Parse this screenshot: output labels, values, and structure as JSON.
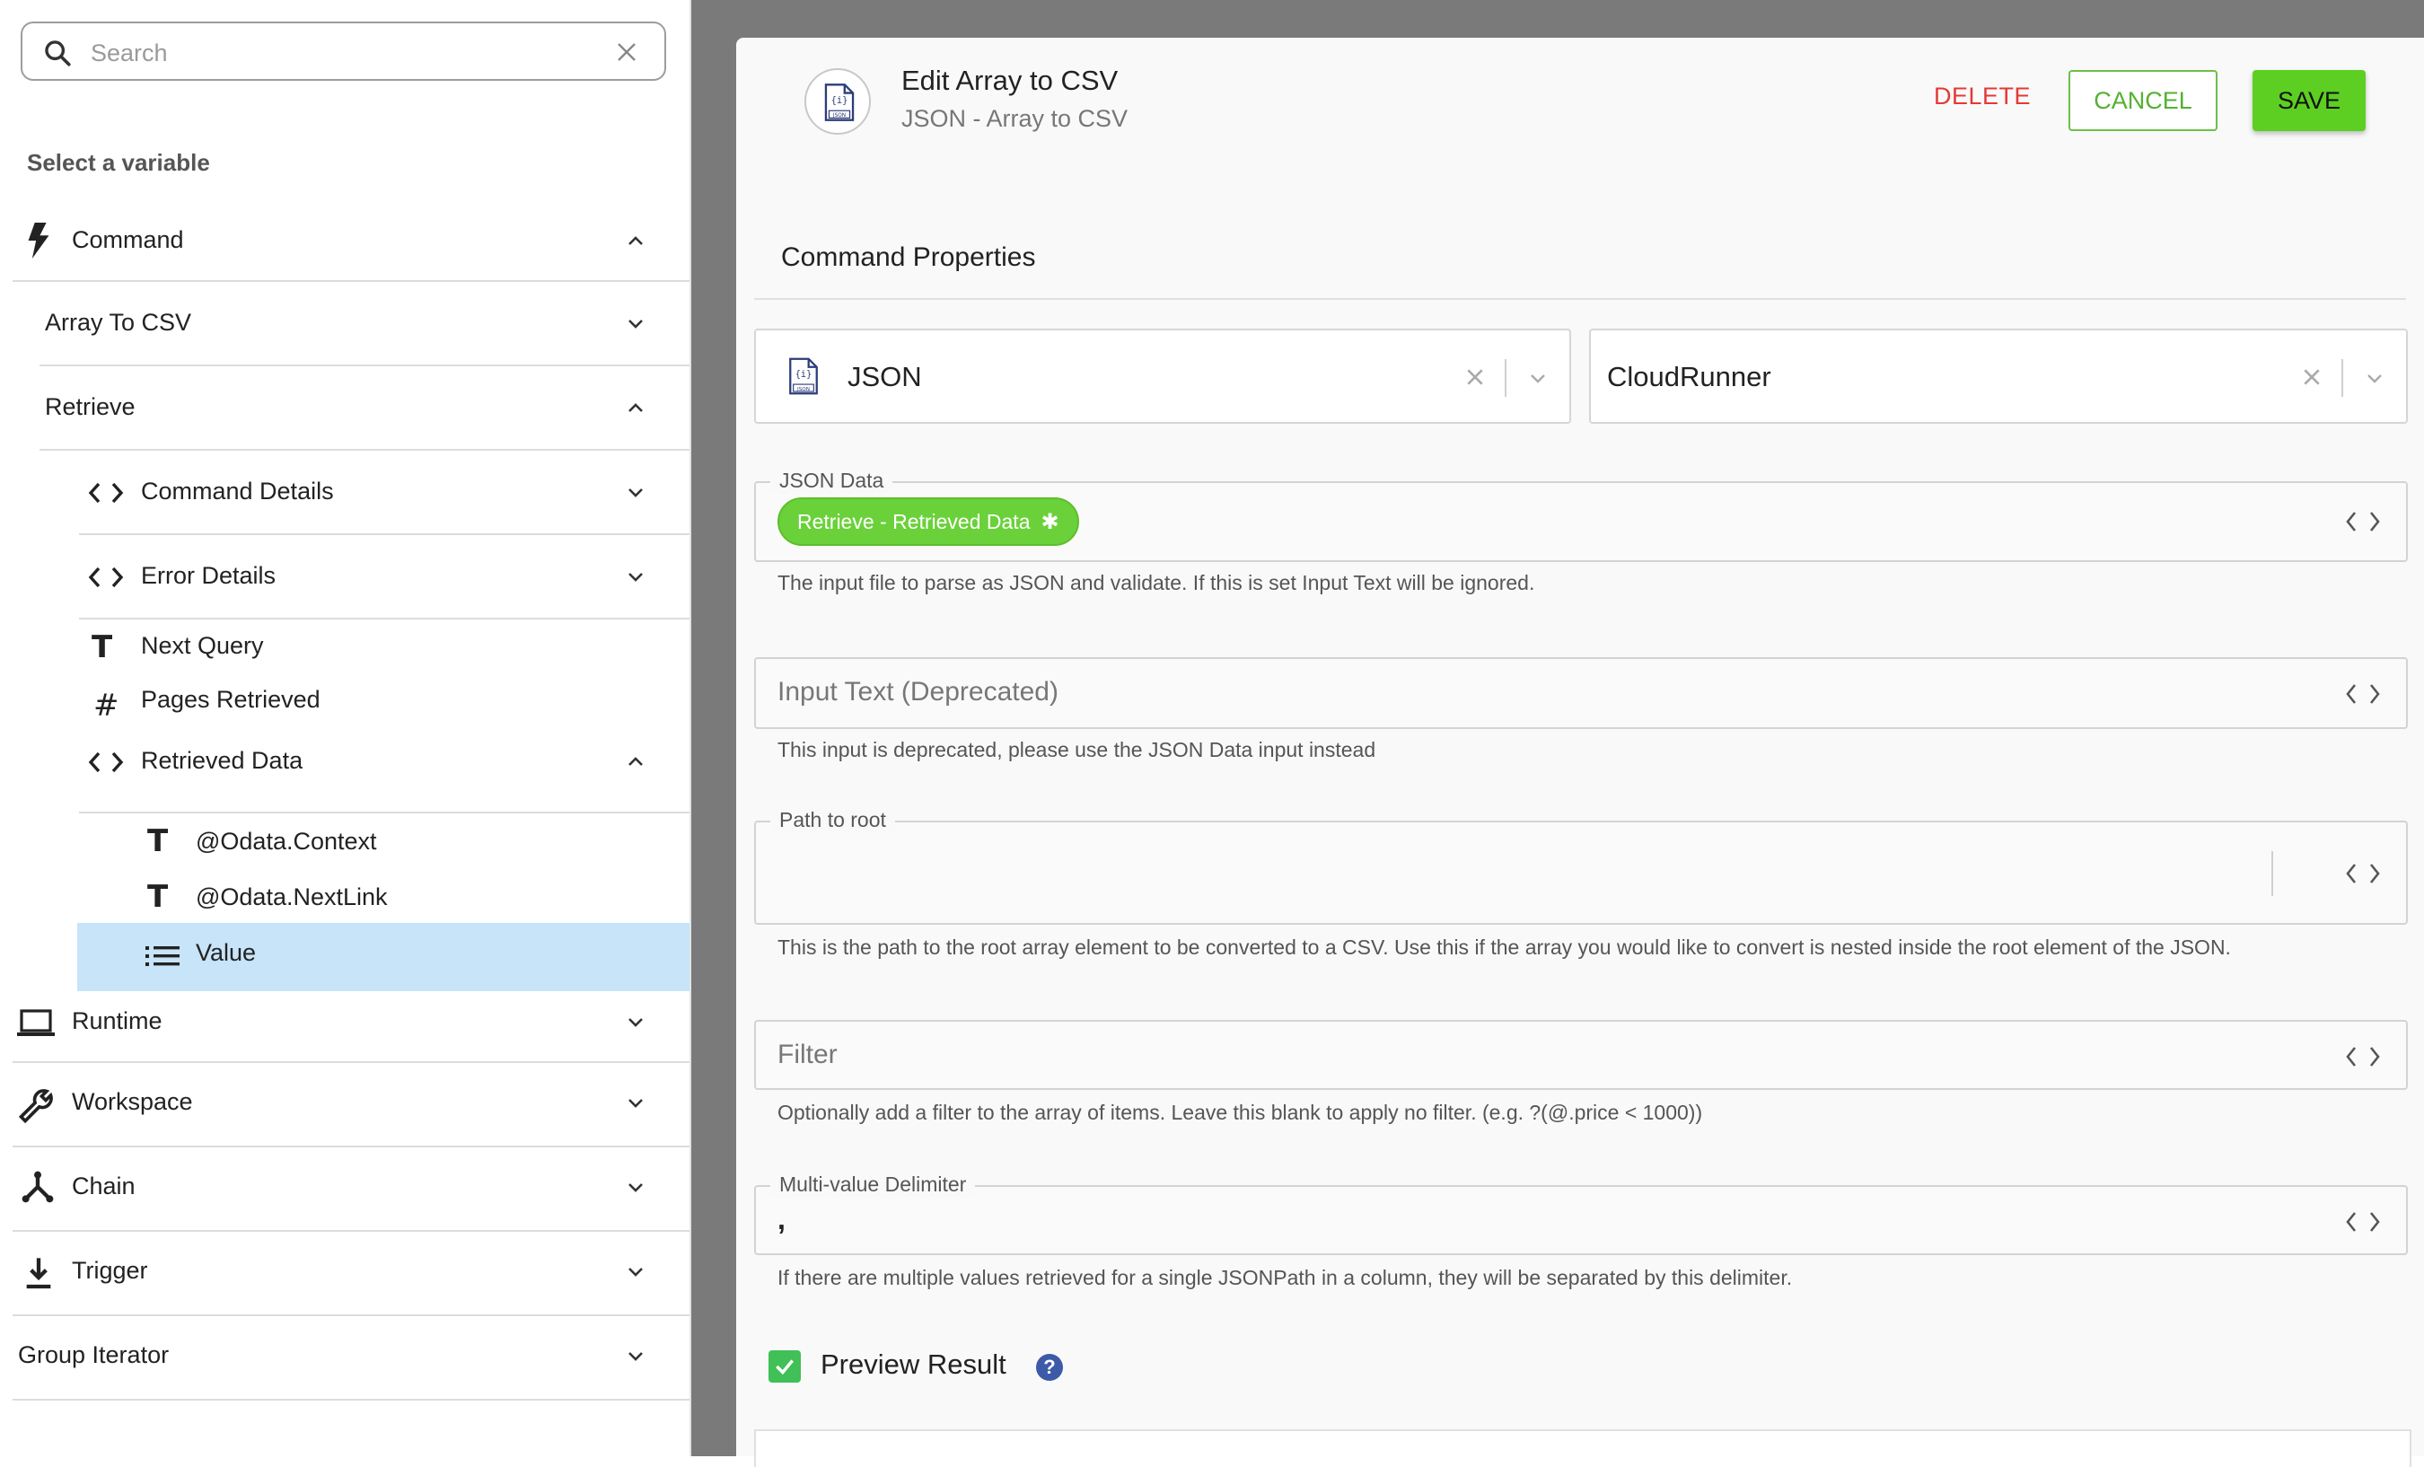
{
  "sidebar": {
    "search": {
      "placeholder": "Search"
    },
    "select_label": "Select a variable",
    "items": {
      "command": "Command",
      "array_to_csv": "Array To CSV",
      "retrieve": "Retrieve",
      "command_details": "Command Details",
      "error_details": "Error Details",
      "next_query": "Next Query",
      "pages_retrieved": "Pages Retrieved",
      "retrieved_data": "Retrieved Data",
      "odata_context": "@Odata.Context",
      "odata_nextlink": "@Odata.NextLink",
      "value": "Value",
      "runtime": "Runtime",
      "workspace": "Workspace",
      "chain": "Chain",
      "trigger": "Trigger",
      "group_iterator": "Group Iterator"
    },
    "icons": {
      "text_type": "T",
      "number_type": "#"
    },
    "selected_color": "#c7e4f9"
  },
  "modal": {
    "title": "Edit Array to CSV",
    "subtitle": "JSON - Array to CSV",
    "delete_label": "DELETE",
    "cancel_label": "CANCEL",
    "save_label": "SAVE",
    "section_title": "Command Properties",
    "connector_select": "JSON",
    "runner_select": "CloudRunner",
    "fields": {
      "json_data": {
        "label": "JSON Data",
        "chip": "Retrieve - Retrieved Data",
        "help": "The input file to parse as JSON and validate. If this is set Input Text will be ignored."
      },
      "input_text": {
        "placeholder": "Input Text (Deprecated)",
        "help": "This input is deprecated, please use the JSON Data input instead"
      },
      "path_to_root": {
        "label": "Path to root",
        "help": "This is the path to the root array element to be converted to a CSV. Use this if the array you would like to convert is nested inside the root element of the JSON."
      },
      "filter": {
        "placeholder": "Filter",
        "help": "Optionally add a filter to the array of items. Leave this blank to apply no filter. (e.g. ?(@.price < 1000))"
      },
      "multi_value_delimiter": {
        "label": "Multi-value Delimiter",
        "value": ",",
        "help": "If there are multiple values retrieved for a single JSONPath in a column, they will be separated by this delimiter."
      }
    },
    "preview": {
      "label": "Preview Result",
      "checked": true,
      "help_icon": "?"
    },
    "colors": {
      "save": "#5ccf22",
      "cancel": "#55b032",
      "delete": "#e53935",
      "chip": "#6bd13a"
    }
  }
}
